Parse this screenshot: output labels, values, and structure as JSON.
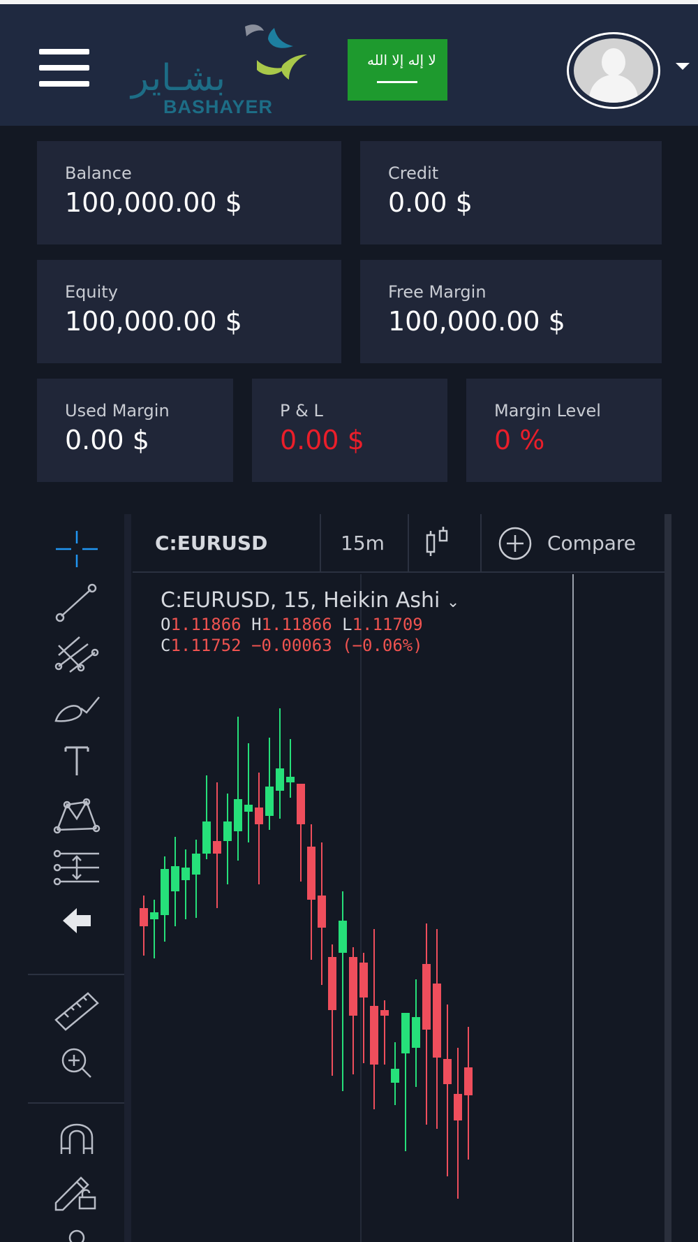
{
  "header": {
    "menu_icon": "hamburger-menu-icon",
    "logo_text": "BASHAYER",
    "logo_arabic": "بشـاير",
    "flag_script": "لا إله إلا الله",
    "flag_icon": "saudi-arabia-flag",
    "avatar_icon": "user-avatar-icon",
    "caret_icon": "caret-down-icon"
  },
  "account": {
    "balance": {
      "label": "Balance",
      "value": "100,000.00 $"
    },
    "credit": {
      "label": "Credit",
      "value": "0.00 $"
    },
    "equity": {
      "label": "Equity",
      "value": "100,000.00 $"
    },
    "free_margin": {
      "label": "Free Margin",
      "value": "100,000.00 $"
    },
    "used_margin": {
      "label": "Used Margin",
      "value": "0.00 $"
    },
    "pnl": {
      "label": "P & L",
      "value": "0.00 $"
    },
    "margin_level": {
      "label": "Margin Level",
      "value": "0 %"
    }
  },
  "colors": {
    "background": "#131823",
    "card": "#202638",
    "header": "#1f2940",
    "negative": "#ea1e2a",
    "candle_up": "#26e07a",
    "candle_down": "#ef4e5c",
    "crosshair": "#2196f3"
  },
  "chart": {
    "symbol": "C:EURUSD",
    "interval": "15m",
    "compare_label": "Compare",
    "legend_title": "C:EURUSD, 15, Heikin Ashi",
    "o_label": "O",
    "o_value": "1.11866",
    "h_label": "H",
    "h_value": "1.11866",
    "l_label": "L",
    "l_value": "1.11709",
    "c_label": "C",
    "c_value": "1.11752",
    "change": "−0.00063 (−0.06%)",
    "toolbar_icons": [
      "crosshair-icon",
      "trend-line-icon",
      "pitchfork-icon",
      "brush-icon",
      "text-icon",
      "pattern-icon",
      "measure-levels-icon",
      "back-arrow-icon",
      "ruler-icon",
      "zoom-in-icon",
      "magnet-icon",
      "lock-drawing-icon"
    ]
  }
}
